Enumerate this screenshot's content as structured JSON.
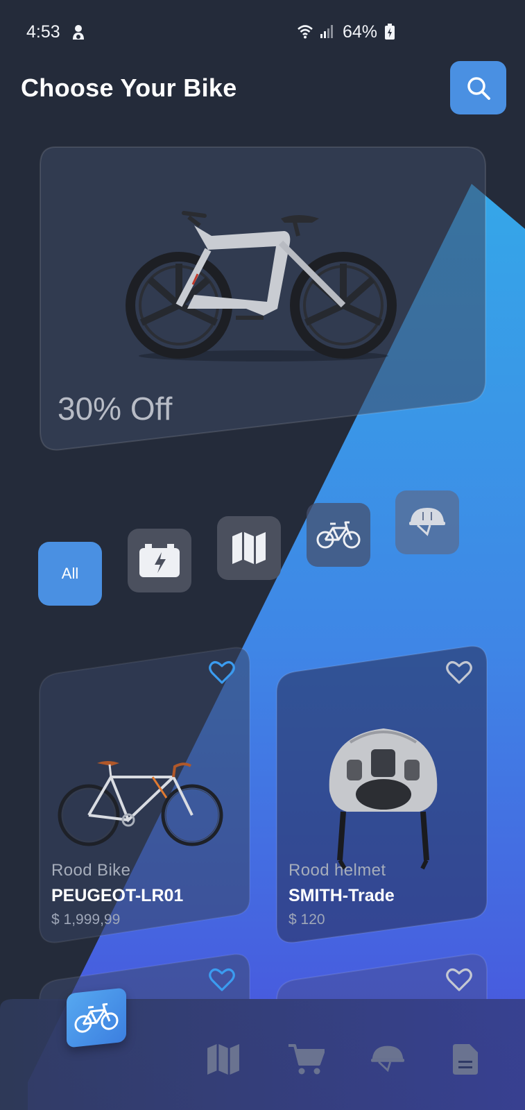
{
  "status_bar": {
    "time": "4:53",
    "battery": "64%"
  },
  "header": {
    "title": "Choose Your Bike",
    "search_icon": "search-icon"
  },
  "banner": {
    "discount": "30% Off",
    "image": "electric-bike-image"
  },
  "categories": [
    {
      "label": "All",
      "selected": true
    },
    {
      "icon": "battery-charging-icon"
    },
    {
      "icon": "map-icon"
    },
    {
      "icon": "bicycle-icon"
    },
    {
      "icon": "helmet-icon"
    }
  ],
  "products": [
    {
      "category": "Rood Bike",
      "name": "PEUGEOT-LR01",
      "price": "$ 1,999,99",
      "favorite": true
    },
    {
      "category": "Rood helmet",
      "name": "SMITH-Trade",
      "price": "$ 120",
      "favorite": false
    }
  ],
  "bottom_nav": {
    "items": [
      "bicycle-icon",
      "map-icon",
      "cart-icon",
      "helmet-icon",
      "document-icon"
    ],
    "active": "bicycle-icon"
  },
  "colors": {
    "background": "#242b3a",
    "accent": "#4a90e2",
    "gradient_start": "#3aa6ea",
    "gradient_end": "#4a50e0",
    "favorite_active": "#3b9cf0"
  }
}
